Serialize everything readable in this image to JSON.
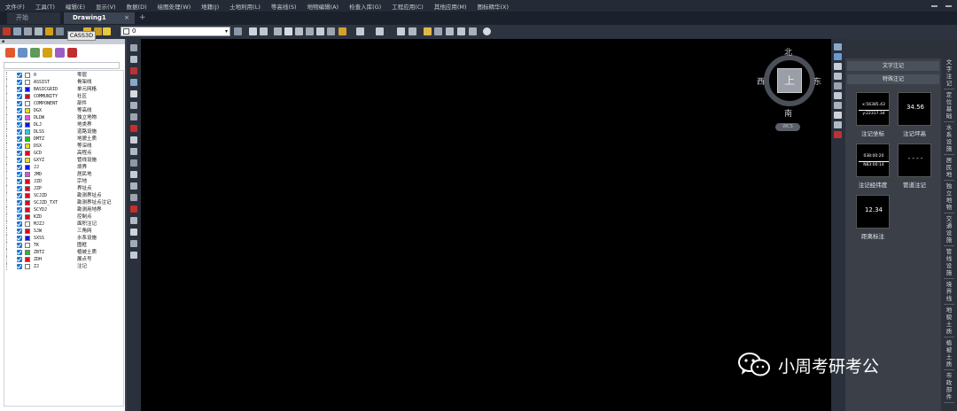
{
  "menu": [
    "文件(F)",
    "工具(T)",
    "编辑(E)",
    "显示(V)",
    "数据(D)",
    "绘图处理(W)",
    "地籍(J)",
    "土地利用(L)",
    "等高线(S)",
    "地物编辑(A)",
    "检查入库(G)",
    "工程应用(C)",
    "其他应用(M)",
    "图标精华(X)"
  ],
  "tabs": {
    "start": "开始",
    "drawing": "Drawing1",
    "close": "×",
    "add": "+"
  },
  "tooltip": "CASS3D",
  "toolbar": {
    "layer_value": "0",
    "dropdown_arrow": "▾"
  },
  "layers": [
    {
      "code": "0",
      "name": "零层",
      "color": "#ffffff"
    },
    {
      "code": "ASSIST",
      "name": "骨架线",
      "color": "#ffffff"
    },
    {
      "code": "BASICGRID",
      "name": "单元网格",
      "color": "#1010ff"
    },
    {
      "code": "COMMUNITY",
      "name": "社区",
      "color": "#e00020"
    },
    {
      "code": "COMPONENT",
      "name": "部件",
      "color": "#ffffff"
    },
    {
      "code": "DGX",
      "name": "等高线",
      "color": "#e8e000"
    },
    {
      "code": "DLDW",
      "name": "独立地物",
      "color": "#e050e0"
    },
    {
      "code": "DLJ",
      "name": "地类界",
      "color": "#1010ff"
    },
    {
      "code": "DLSS",
      "name": "道路设施",
      "color": "#20d0e0"
    },
    {
      "code": "DMTZ",
      "name": "地貌土质",
      "color": "#20c020"
    },
    {
      "code": "DSX",
      "name": "等深线",
      "color": "#e8e000"
    },
    {
      "code": "GCD",
      "name": "高程点",
      "color": "#e00020"
    },
    {
      "code": "GXYZ",
      "name": "管线设施",
      "color": "#e8e000"
    },
    {
      "code": "JJ",
      "name": "境界",
      "color": "#1010ff"
    },
    {
      "code": "JMD",
      "name": "居民地",
      "color": "#e050e0"
    },
    {
      "code": "JZD",
      "name": "宗地",
      "color": "#e00020"
    },
    {
      "code": "JZP",
      "name": "界址点",
      "color": "#e00020"
    },
    {
      "code": "SCJZD",
      "name": "勘测界址点",
      "color": "#e00020"
    },
    {
      "code": "SCJZD_TXT",
      "name": "勘测界址点注记",
      "color": "#e00020"
    },
    {
      "code": "SCYDJ",
      "name": "勘测用地界",
      "color": "#e00020"
    },
    {
      "code": "KZD",
      "name": "控制点",
      "color": "#e00020"
    },
    {
      "code": "MJZJ",
      "name": "面积注记",
      "color": "#ffffff"
    },
    {
      "code": "SJW",
      "name": "三角网",
      "color": "#e00020"
    },
    {
      "code": "SXSS",
      "name": "水系设施",
      "color": "#1010ff"
    },
    {
      "code": "TK",
      "name": "图框",
      "color": "#ffffff"
    },
    {
      "code": "ZBTZ",
      "name": "植被土质",
      "color": "#20c020"
    },
    {
      "code": "ZDH",
      "name": "展点号",
      "color": "#e00020"
    },
    {
      "code": "ZJ",
      "name": "注记",
      "color": "#ffffff"
    }
  ],
  "viewcube": {
    "north": "北",
    "south": "南",
    "east": "东",
    "west": "西",
    "face": "上",
    "ucs": "WCS"
  },
  "annotation_panel": {
    "header1": "文字注记",
    "header2": "特殊注记",
    "items": [
      {
        "label": "注记坐标",
        "line1": "x:56385.43",
        "line2": "y:22317.34"
      },
      {
        "label": "注记坪高",
        "big": "34.56"
      },
      {
        "label": "注记经纬度",
        "line1": "038:00:20",
        "line2": "N83:00:14"
      },
      {
        "label": "管道注记",
        "big": "- - - -"
      },
      {
        "label": "距离标注",
        "big": "12.34"
      }
    ]
  },
  "vertical_tabs": [
    "文字注记",
    "定位基础",
    "水系设施",
    "居民地",
    "独立地物",
    "交通设施",
    "管线设施",
    "境界线",
    "地貌土质",
    "植被土质",
    "市政部件"
  ],
  "watermark": "小周考研考公",
  "colors": {
    "canvas": "#000000",
    "check": "#1b76d1",
    "panel": "#3a3f48"
  }
}
